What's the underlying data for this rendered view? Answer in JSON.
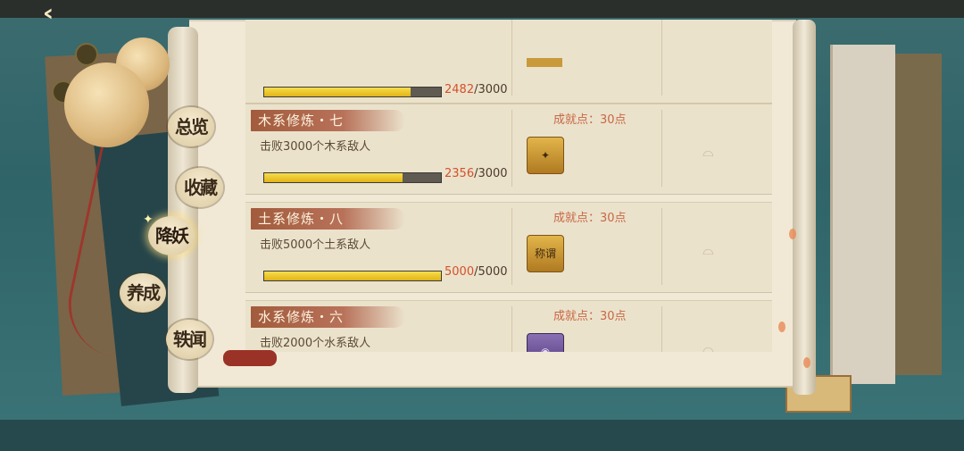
{
  "header": {
    "back_icon": "back-arrow-icon",
    "back_glyph": "‹"
  },
  "nav": {
    "items": [
      {
        "label": "总览"
      },
      {
        "label": "收藏"
      },
      {
        "label": "降妖",
        "active": true
      },
      {
        "label": "养成"
      },
      {
        "label": "轶闻"
      }
    ]
  },
  "achievements": [
    {
      "name": "",
      "desc": "",
      "progress_current": "2482",
      "progress_total": "3000",
      "progress_sep": "/",
      "progress_fraction": 0.827
    },
    {
      "name": "木系修炼・七",
      "desc": "击败3000个木系敌人",
      "reward_label": "成就点：30点",
      "reward_icon": "green-gem-cage-icon",
      "progress_current": "2356",
      "progress_total": "3000",
      "progress_sep": "/",
      "progress_fraction": 0.785
    },
    {
      "name": "土系修炼・八",
      "desc": "击败5000个土系敌人",
      "reward_label": "成就点：30点",
      "reward_icon": "title-scroll-icon",
      "reward_text": "称谓",
      "progress_current": "5000",
      "progress_total": "5000",
      "progress_sep": "/",
      "progress_fraction": 1.0
    },
    {
      "name": "水系修炼・六",
      "desc": "击败2000个水系敌人",
      "reward_label": "成就点：30点",
      "reward_icon": "purple-orb-icon"
    }
  ],
  "colors": {
    "accent": "#c86844",
    "progress_fill": "#e2b316",
    "progress_current": "#d4512b"
  }
}
